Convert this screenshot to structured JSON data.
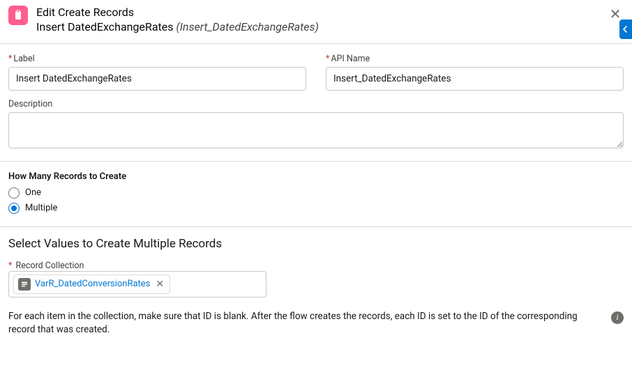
{
  "header": {
    "title": "Edit Create Records",
    "subtitle_name": "Insert DatedExchangeRates",
    "subtitle_api": "(Insert_DatedExchangeRates)"
  },
  "fields": {
    "label_label": "Label",
    "label_value": "Insert DatedExchangeRates",
    "api_label": "API Name",
    "api_value": "Insert_DatedExchangeRates",
    "desc_label": "Description",
    "desc_value": ""
  },
  "howMany": {
    "question": "How Many Records to Create",
    "options": {
      "one": "One",
      "multiple": "Multiple"
    },
    "selected": "multiple"
  },
  "selectValues": {
    "heading": "Select Values to Create Multiple Records",
    "record_collection_label": "Record Collection",
    "pill_label": "VarR_DatedConversionRates",
    "help_text": "For each item in the collection, make sure that ID is blank. After the flow creates the records, each ID is set to the ID of the corresponding record that was created."
  }
}
